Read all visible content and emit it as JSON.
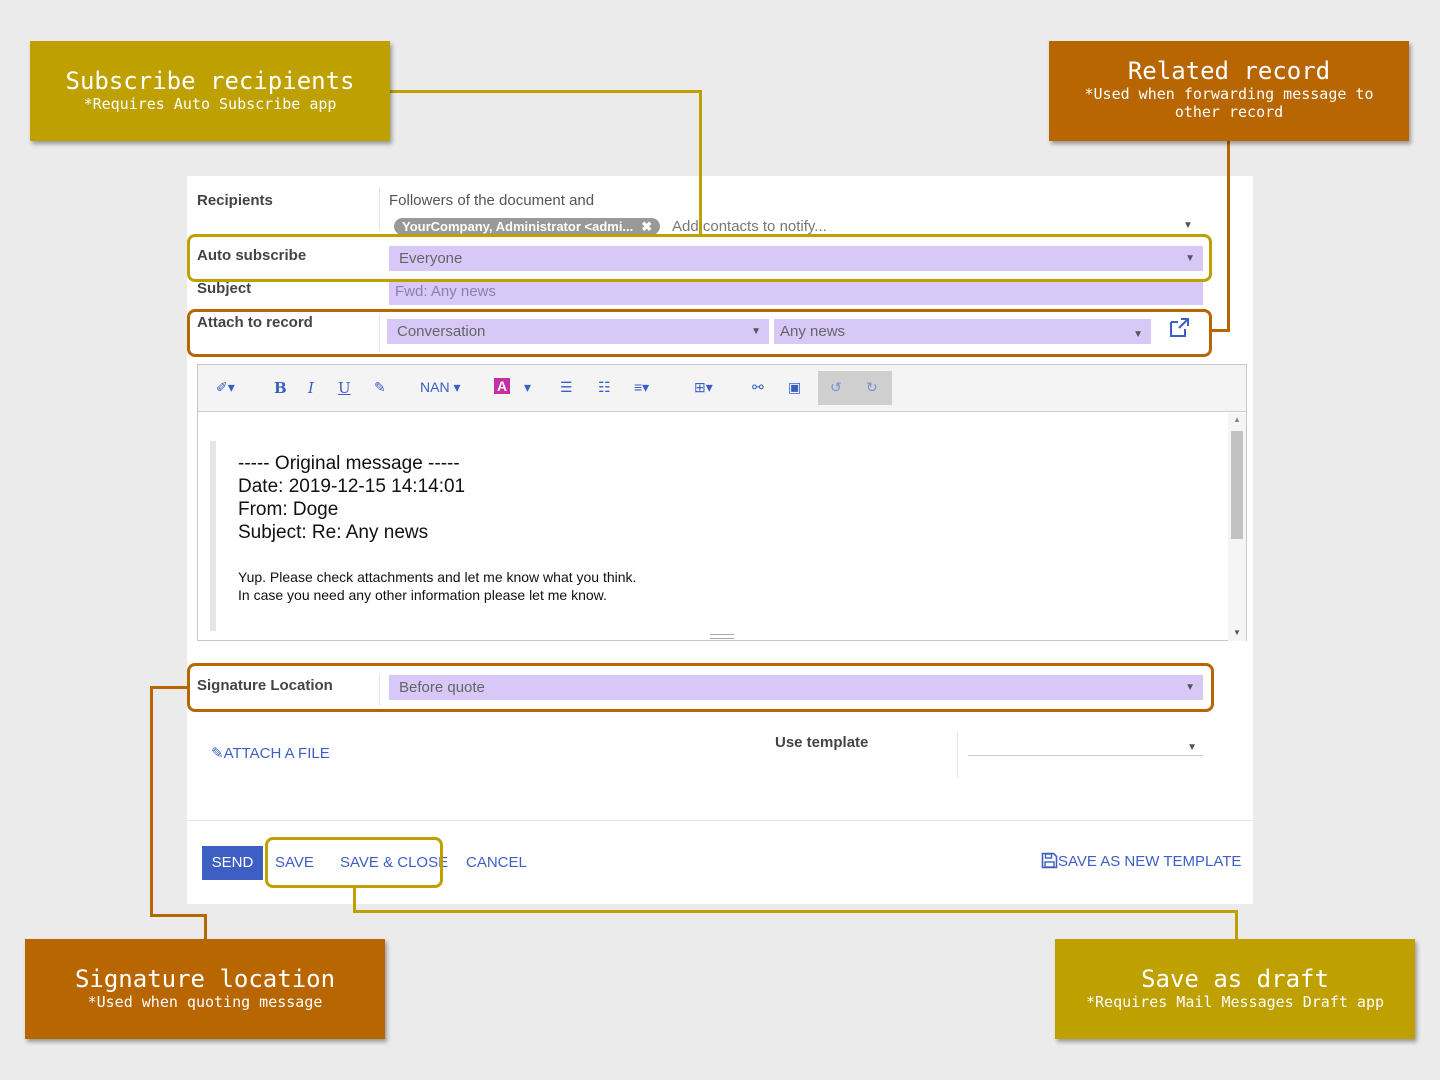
{
  "form": {
    "recipients_label": "Recipients",
    "recipients_text": "Followers of the document and",
    "recipient_tag": "YourCompany, Administrator <admi...",
    "recipient_tag_remove": "✖",
    "recipients_placeholder": "Add contacts to notify...",
    "auto_subscribe_label": "Auto subscribe",
    "auto_subscribe_value": "Everyone",
    "subject_label": "Subject",
    "subject_value": "Fwd: Any news",
    "attach_label": "Attach to record",
    "attach_model": "Conversation",
    "attach_record": "Any news",
    "signature_label": "Signature Location",
    "signature_value": "Before quote",
    "attach_file": "✎ATTACH A FILE",
    "use_template_label": "Use template"
  },
  "toolbar": {
    "font_size": "NAN"
  },
  "message": {
    "header": "----- Original message -----",
    "date": "Date: 2019-12-15 14:14:01",
    "from": "From: Doge",
    "subject": "Subject: Re: Any news",
    "line1": "Yup. Please check attachments and let me know what you think.",
    "line2": "In case you need any other information please let me know."
  },
  "footer": {
    "send": "SEND",
    "save": "SAVE",
    "save_close": "SAVE & CLOSE",
    "cancel": "CANCEL",
    "save_template": "SAVE AS NEW TEMPLATE"
  },
  "callouts": {
    "subscribe_title": "Subscribe recipients",
    "subscribe_sub": "*Requires Auto Subscribe app",
    "related_title": "Related record",
    "related_sub": "*Used when forwarding message to other record",
    "signature_title": "Signature location",
    "signature_sub": "*Used when quoting message",
    "draft_title": "Save as draft",
    "draft_sub": "*Requires Mail Messages Draft app"
  },
  "colors": {
    "gold": "#bea100",
    "orange": "#b76601",
    "field": "#d7c8f7",
    "primary": "#3d5fc4"
  }
}
